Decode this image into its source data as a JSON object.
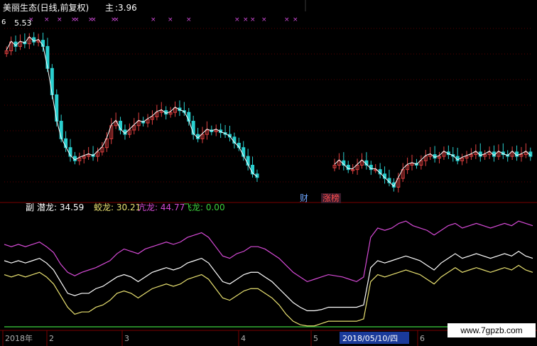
{
  "main_panel": {
    "stock_title": "美丽生态(日线,前复权)",
    "main_label": "主",
    "main_value": "3.96",
    "price_label": "5.53",
    "corner_label": "6",
    "tags": {
      "cai": "财",
      "zhangbang": "涨榜"
    },
    "colors": {
      "up": "#e04040",
      "down": "#2ad0d0",
      "ma": "#ffffff",
      "marker": "#d04bd8",
      "grid": "#5a0000"
    }
  },
  "sub_panel": {
    "prefix": "副",
    "indicators": [
      {
        "label": "潜龙:",
        "value": "34.59",
        "color": "#ffffff"
      },
      {
        "label": "蛟龙:",
        "value": "30.21",
        "color": "#e8e070"
      },
      {
        "label": "亢龙:",
        "value": "44.77",
        "color": "#d64ad6"
      },
      {
        "label": "飞龙:",
        "value": "0.00",
        "color": "#3ccf3c"
      }
    ]
  },
  "time_axis": {
    "labels": [
      "2018年",
      "2",
      "3",
      "4",
      "5",
      "6"
    ],
    "cursor_date": "2018/05/10/四"
  },
  "watermark": "www.7gpzb.com",
  "chart_data": [
    {
      "type": "candlestick",
      "title": "美丽生态(日线,前复权)",
      "note": "main price panel, approximate shape",
      "x": [
        0,
        1,
        2,
        3,
        4,
        5,
        6,
        7,
        8,
        9,
        10,
        11,
        12,
        13,
        14,
        15,
        16,
        17,
        18,
        19,
        20,
        21,
        22,
        23,
        24,
        25,
        26,
        27,
        28,
        29,
        30,
        31,
        32,
        33,
        34,
        35,
        36,
        37,
        38,
        39,
        40,
        41,
        42,
        43,
        44,
        45,
        46,
        47,
        48,
        49,
        50,
        51,
        52,
        53,
        54,
        55,
        56,
        57,
        58,
        59,
        60,
        61,
        62,
        63,
        64,
        65,
        66,
        67,
        68,
        69,
        70,
        71,
        72,
        73,
        74,
        75,
        76,
        77,
        78,
        79,
        80,
        81,
        82,
        83,
        84,
        85,
        86,
        87,
        88,
        89,
        90,
        91,
        92,
        93,
        94,
        95,
        96,
        97,
        98,
        99,
        100,
        101,
        102,
        103,
        104,
        105,
        106,
        107,
        108,
        109,
        110,
        111,
        112,
        113,
        114,
        115
      ],
      "close": [
        5.4,
        5.5,
        5.45,
        5.5,
        5.48,
        5.55,
        5.5,
        5.52,
        5.45,
        5.2,
        4.9,
        4.6,
        4.4,
        4.3,
        4.2,
        4.15,
        4.18,
        4.2,
        4.22,
        4.2,
        4.25,
        4.3,
        4.4,
        4.55,
        4.6,
        4.5,
        4.45,
        4.5,
        4.55,
        4.6,
        4.58,
        4.62,
        4.65,
        4.7,
        4.72,
        4.68,
        4.7,
        4.75,
        4.72,
        4.7,
        4.6,
        4.45,
        4.4,
        4.45,
        4.5,
        4.48,
        4.5,
        4.47,
        4.45,
        4.42,
        4.35,
        4.3,
        4.2,
        4.1,
        4.0,
        3.96,
        null,
        null,
        null,
        null,
        null,
        null,
        null,
        null,
        null,
        null,
        null,
        null,
        null,
        null,
        null,
        null,
        4.1,
        4.15,
        4.1,
        4.05,
        4.05,
        4.1,
        4.15,
        4.1,
        4.05,
        4.05,
        4.0,
        3.95,
        3.9,
        3.85,
        3.95,
        4.05,
        4.1,
        4.12,
        4.1,
        4.15,
        4.2,
        4.22,
        4.18,
        4.2,
        4.25,
        4.22,
        4.2,
        4.15,
        4.18,
        4.2,
        4.22,
        4.25,
        4.2,
        4.22,
        4.25,
        4.2,
        4.25,
        4.22,
        4.2,
        4.25,
        4.2,
        4.22,
        4.25,
        4.2
      ]
    },
    {
      "type": "line",
      "title": "",
      "series": [
        {
          "name": "潜龙",
          "last": 34.59
        },
        {
          "name": "蛟龙",
          "last": 30.21
        },
        {
          "name": "亢龙",
          "last": 44.77
        },
        {
          "name": "飞龙",
          "last": 0.0
        }
      ]
    }
  ]
}
